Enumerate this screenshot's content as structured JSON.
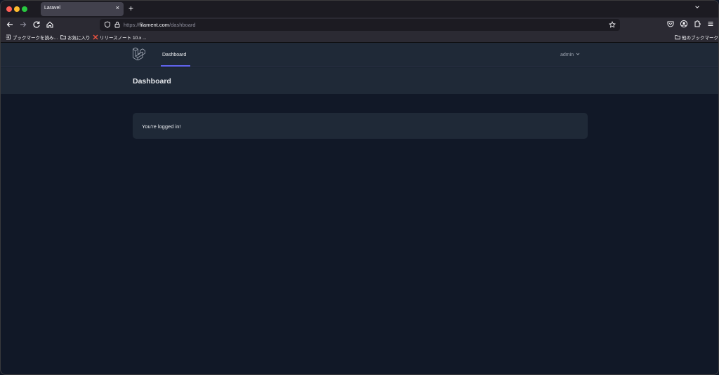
{
  "browser": {
    "tab_title": "Laravel",
    "tab_close": "×",
    "new_tab": "+",
    "url_scheme": "https://",
    "url_host": "filament.com",
    "url_path": "/dashboard"
  },
  "bookmarks": {
    "items": [
      {
        "label": "ブックマークを読み…"
      },
      {
        "label": "お気に入り"
      },
      {
        "label": "リリースノート 10.x ..."
      }
    ],
    "other_label": "他のブックマーク"
  },
  "app": {
    "nav": {
      "dashboard_label": "Dashboard"
    },
    "user": {
      "name": "admin"
    },
    "header": {
      "title": "Dashboard"
    },
    "card": {
      "message": "You're logged in!"
    }
  },
  "colors": {
    "accent": "#6366f1",
    "background": "#111827",
    "panel": "#1f2937"
  }
}
